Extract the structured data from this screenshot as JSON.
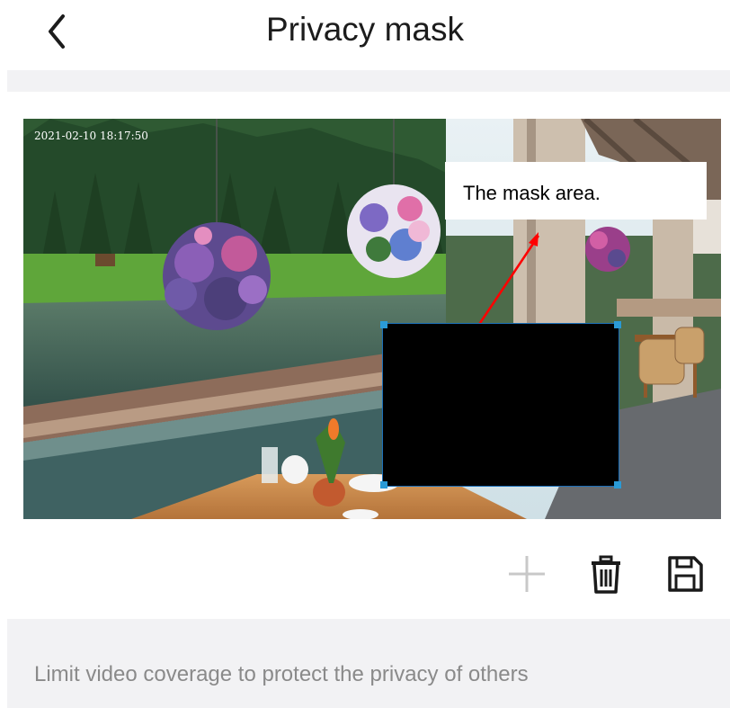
{
  "header": {
    "title": "Privacy mask",
    "back_icon": "chevron-left-icon"
  },
  "video": {
    "timestamp": "2021-02-10 18:17:50"
  },
  "annotation": {
    "text": "The mask area.",
    "arrow_color": "#ff0000"
  },
  "toolbar": {
    "icons": [
      "plus-icon",
      "trash-icon",
      "save-icon"
    ]
  },
  "footer": {
    "hint": "Limit video coverage to protect the privacy of others"
  },
  "colors": {
    "accent": "#2a9ad6",
    "band": "#f2f2f4",
    "hint_text": "#8a8a8a"
  }
}
